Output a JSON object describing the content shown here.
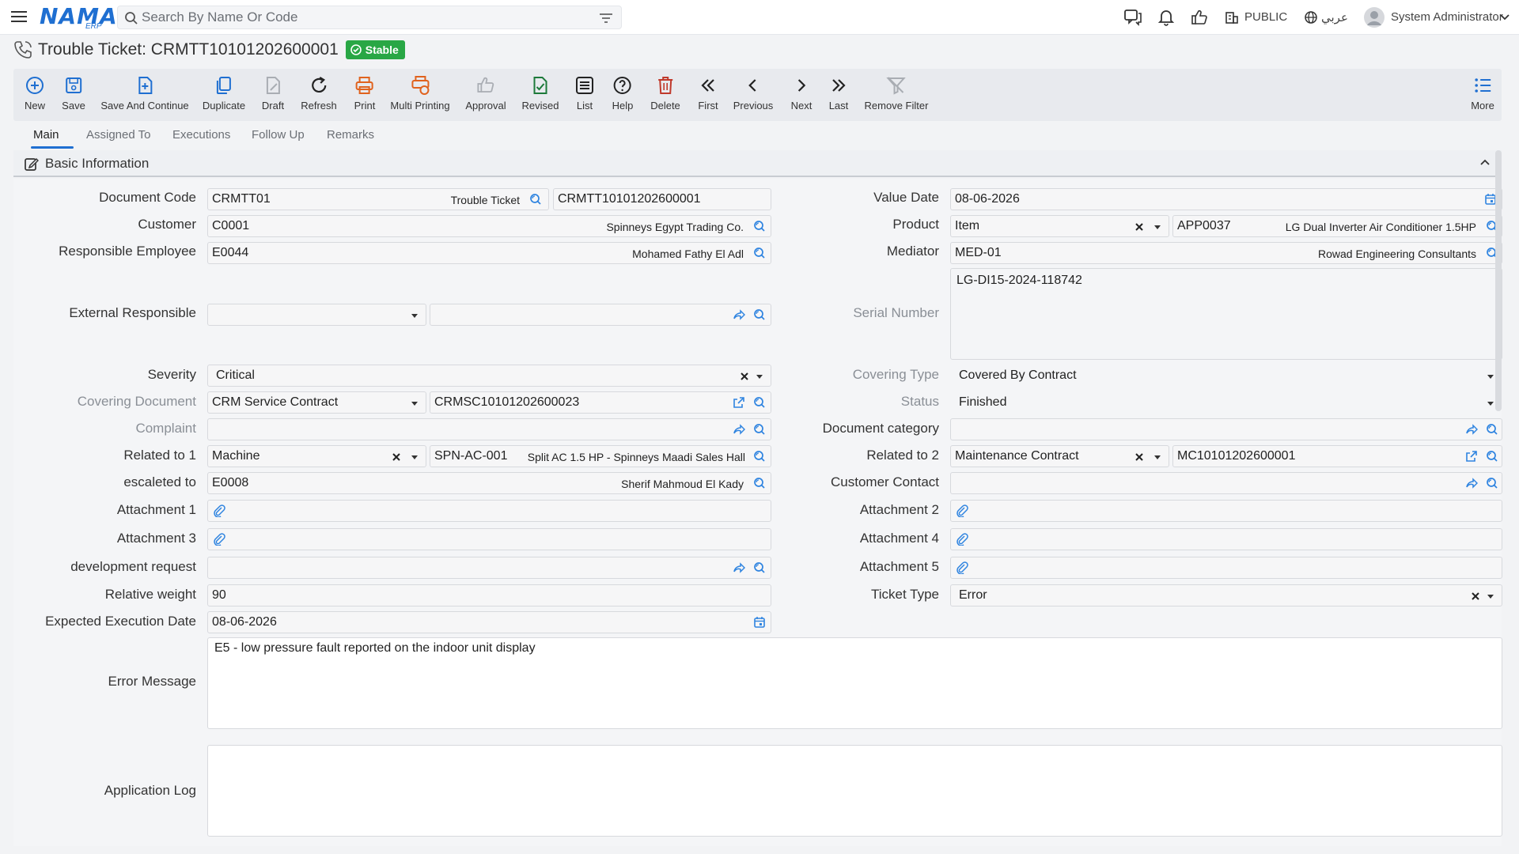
{
  "app": {
    "logo": "NAMA",
    "logo_sub": "ERP",
    "search_placeholder": "Search By Name Or Code",
    "public_label": "PUBLIC",
    "language_label": "عربي",
    "user_name": "System Administrator"
  },
  "page": {
    "title": "Trouble Ticket: CRMTT10101202600001",
    "status_badge": "Stable"
  },
  "toolbar": [
    {
      "label": "New",
      "icon": "plus-circle-icon"
    },
    {
      "label": "Save",
      "icon": "save-icon"
    },
    {
      "label": "Save And Continue",
      "icon": "save-continue-icon"
    },
    {
      "label": "Duplicate",
      "icon": "duplicate-icon"
    },
    {
      "label": "Draft",
      "icon": "draft-icon"
    },
    {
      "label": "Refresh",
      "icon": "refresh-icon"
    },
    {
      "label": "Print",
      "icon": "print-icon"
    },
    {
      "label": "Multi Printing",
      "icon": "multi-print-icon"
    },
    {
      "label": "Approval",
      "icon": "approval-icon"
    },
    {
      "label": "Revised",
      "icon": "revised-icon"
    },
    {
      "label": "List",
      "icon": "list-icon"
    },
    {
      "label": "Help",
      "icon": "help-icon"
    },
    {
      "label": "Delete",
      "icon": "delete-icon"
    },
    {
      "label": "First",
      "icon": "first-icon"
    },
    {
      "label": "Previous",
      "icon": "previous-icon"
    },
    {
      "label": "Next",
      "icon": "next-icon"
    },
    {
      "label": "Last",
      "icon": "last-icon"
    },
    {
      "label": "Remove Filter",
      "icon": "remove-filter-icon"
    },
    {
      "label": "More",
      "icon": "more-icon"
    }
  ],
  "tabs": [
    "Main",
    "Assigned To",
    "Executions",
    "Follow Up",
    "Remarks"
  ],
  "section": {
    "title": "Basic Information"
  },
  "labels": {
    "document_code": "Document Code",
    "customer": "Customer",
    "responsible_employee": "Responsible Employee",
    "external_responsible": "External Responsible",
    "severity": "Severity",
    "covering_document": "Covering Document",
    "complaint": "Complaint",
    "related_to_1": "Related to 1",
    "escalated_to": "escaleted to",
    "attachment_1": "Attachment 1",
    "attachment_3": "Attachment 3",
    "development_request": "development request",
    "relative_weight": "Relative weight",
    "expected_execution_date": "Expected Execution Date",
    "error_message": "Error Message",
    "application_log": "Application Log",
    "value_date": "Value Date",
    "product": "Product",
    "mediator": "Mediator",
    "serial_number": "Serial Number",
    "covering_type": "Covering Type",
    "status": "Status",
    "document_category": "Document category",
    "related_to_2": "Related to 2",
    "customer_contact": "Customer Contact",
    "attachment_2": "Attachment 2",
    "attachment_4": "Attachment 4",
    "attachment_5": "Attachment 5",
    "ticket_type": "Ticket Type"
  },
  "values": {
    "document_code": "CRMTT01",
    "document_code_desc": "Trouble Ticket",
    "document_number": "CRMTT10101202600001",
    "customer_code": "C0001",
    "customer_name": "Spinneys Egypt Trading Co.",
    "employee_code": "E0044",
    "employee_name": "Mohamed Fathy El Adl",
    "severity": "Critical",
    "covering_document_type": "CRM Service Contract",
    "covering_document_code": "CRMSC10101202600023",
    "related_to_1_type": "Machine",
    "related_to_1_code": "SPN-AC-001",
    "related_to_1_desc": "Split AC 1.5 HP - Spinneys Maadi Sales Hall",
    "escalated_code": "E0008",
    "escalated_name": "Sherif Mahmoud El Kady",
    "relative_weight": "90",
    "expected_execution_date": "08-06-2026",
    "error_message": "E5 - low pressure fault reported on the indoor unit display",
    "value_date": "08-06-2026",
    "product_type": "Item",
    "product_code": "APP0037",
    "product_name": "LG Dual Inverter Air Conditioner 1.5HP",
    "mediator_code": "MED-01",
    "mediator_name": "Rowad Engineering Consultants",
    "serial_number": "LG-DI15-2024-118742",
    "covering_type": "Covered By Contract",
    "status": "Finished",
    "related_to_2_type": "Maintenance Contract",
    "related_to_2_code": "MC10101202600001",
    "ticket_type": "Error"
  },
  "colors": {
    "accent": "#1f6fd1",
    "badge": "#29a745",
    "delete": "#c0392b",
    "print": "#e0621d"
  }
}
